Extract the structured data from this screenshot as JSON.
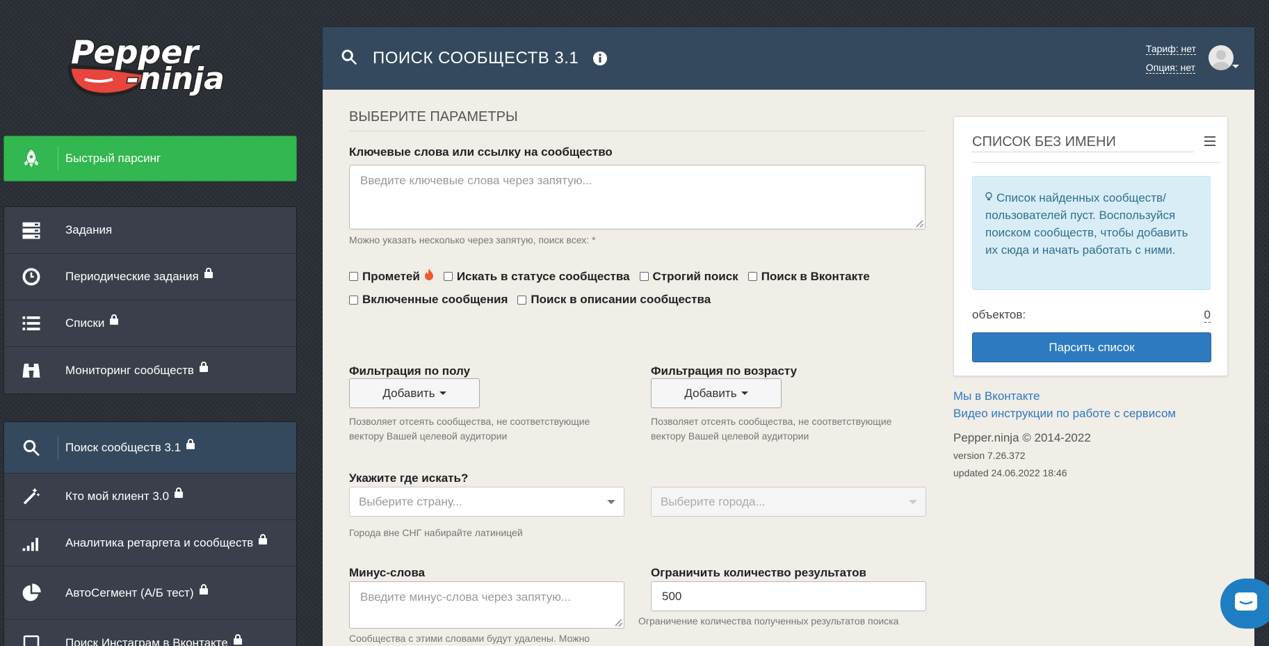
{
  "brand": {
    "logo_line1": "Pepper",
    "logo_line2": "ninja"
  },
  "sidebar": {
    "fast": {
      "label": "Быстрый парсинг",
      "icon": "rocket-icon"
    },
    "group1": [
      {
        "label": "Задания",
        "icon": "server-icon",
        "locked": false
      },
      {
        "label": "Периодические задания",
        "icon": "clock-icon",
        "locked": true
      },
      {
        "label": "Списки",
        "icon": "list-icon",
        "locked": true
      },
      {
        "label": "Мониторинг сообществ",
        "icon": "binoculars-icon",
        "locked": true
      }
    ],
    "group2": [
      {
        "label": "Поиск сообществ 3.1",
        "icon": "search-icon",
        "locked": true,
        "active": true
      },
      {
        "label": "Кто мой клиент 3.0",
        "icon": "magic-wand-icon",
        "locked": true
      },
      {
        "label": "Аналитика ретаргета и сообществ",
        "icon": "signal-bars-icon",
        "locked": true
      },
      {
        "label": "АвтоСегмент (А/Б тест)",
        "icon": "pie-chart-icon",
        "locked": true
      },
      {
        "label": "Поиск Инстаграм в Вконтакте",
        "icon": "instagram-vk-icon",
        "locked": true
      }
    ]
  },
  "header": {
    "title": "ПОИСК СООБЩЕСТВ 3.1",
    "tariff": "Тариф: нет",
    "option": "Опция: нет"
  },
  "form": {
    "section_title": "ВЫБЕРИТЕ ПАРАМЕТРЫ",
    "keywords_label": "Ключевые слова или ссылку на сообщество",
    "keywords_placeholder": "Введите ключевые слова через запятую...",
    "keywords_hint": "Можно указать несколько через запятую, поиск всех: *",
    "checkboxes_row1": [
      "Прометей",
      "Искать в статусе сообщества",
      "Строгий поиск",
      "Поиск в Вконтакте"
    ],
    "checkboxes_row2": [
      "Включенные сообщения",
      "Поиск в описании сообщества"
    ],
    "gender_label": "Фильтрация по полу",
    "gender_button": "Добавить",
    "gender_hint": "Позволяет отсеять сообщества, не соответствующие вектору Вашей целевой аудитории",
    "age_label": "Фильтрация по возрасту",
    "age_button": "Добавить",
    "age_hint": "Позволяет отсеять сообщества, не соответствующие вектору Вашей целевой аудитории",
    "where_label": "Укажите где искать?",
    "country_placeholder": "Выберите страну...",
    "city_placeholder": "Выберите города...",
    "where_hint": "Города вне СНГ набирайте латиницей",
    "minus_label": "Минус-слова",
    "minus_placeholder": "Введите минус-слова через запятую...",
    "minus_hint": "Сообщества с этими словами будут удалены. Можно указать несколько через запятую (,).",
    "limit_label": "Ограничить количество результатов",
    "limit_value": "500",
    "limit_hint": "Ограничение количества полученных результатов поиска"
  },
  "panel": {
    "title": "СПИСОК БЕЗ ИМЕНИ",
    "alert": "Список найденных сообществ/пользователей пуст. Воспользуйся поиском сообществ, чтобы добавить их сюда и начать работать с ними.",
    "objects_label": "объектов:",
    "objects_count": "0",
    "parse_button": "Парсить список"
  },
  "links": {
    "vk": "Мы в Вконтакте",
    "video": "Видео инструкции по работе с сервисом"
  },
  "footer": {
    "copyright": "Pepper.ninja © 2014-2022",
    "version": "version 7.26.372",
    "updated": "updated 24.06.2022 18:46"
  },
  "colors": {
    "green": "#33b750",
    "header": "#34495e",
    "primary": "#2d7ac0",
    "alert_bg": "#d9edf7"
  }
}
